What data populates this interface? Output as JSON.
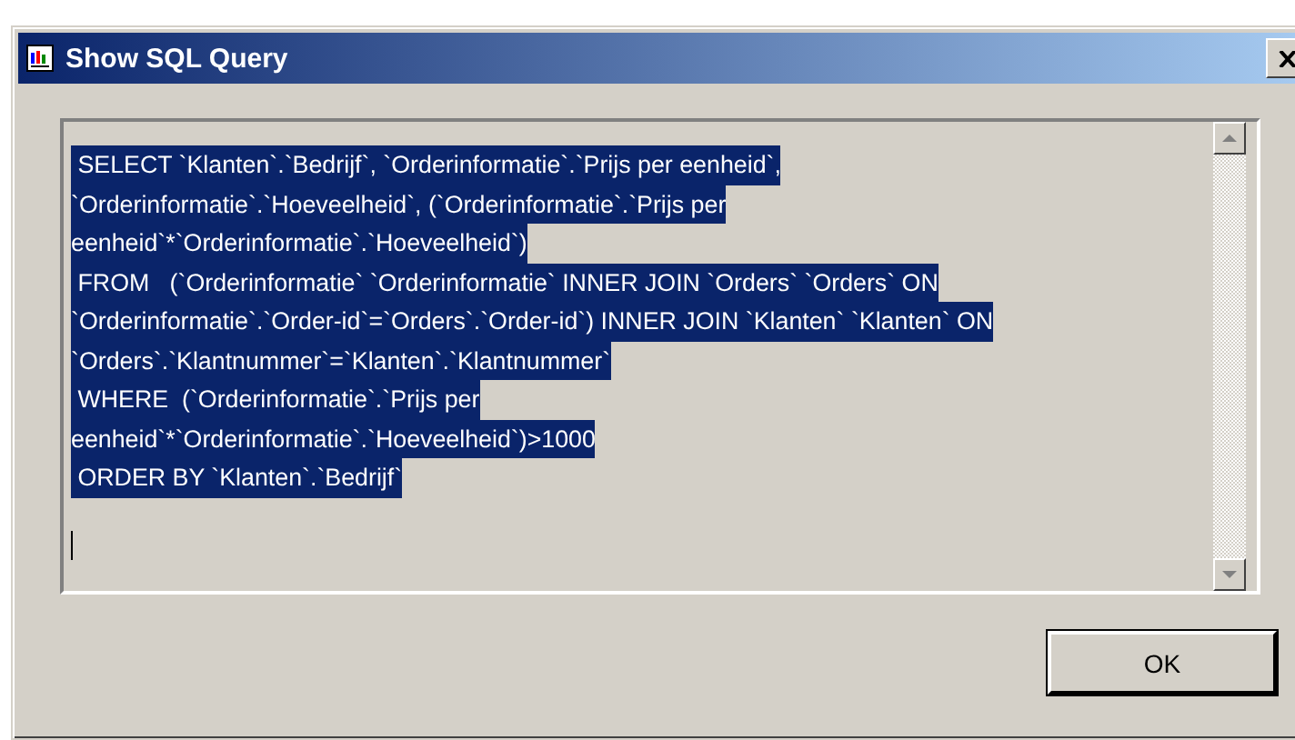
{
  "window": {
    "title": "Show SQL Query"
  },
  "query": {
    "selected": true,
    "lines": [
      " SELECT `Klanten`.`Bedrijf`, `Orderinformatie`.`Prijs per eenheid`,",
      "`Orderinformatie`.`Hoeveelheid`, (`Orderinformatie`.`Prijs per",
      "eenheid`*`Orderinformatie`.`Hoeveelheid`)",
      " FROM   (`Orderinformatie` `Orderinformatie` INNER JOIN `Orders` `Orders` ON",
      "`Orderinformatie`.`Order-id`=`Orders`.`Order-id`) INNER JOIN `Klanten` `Klanten` ON",
      "`Orders`.`Klantnummer`=`Klanten`.`Klantnummer`",
      " WHERE  (`Orderinformatie`.`Prijs per",
      "eenheid`*`Orderinformatie`.`Hoeveelheid`)>1000",
      " ORDER BY `Klanten`.`Bedrijf`"
    ]
  },
  "buttons": [
    "OK"
  ]
}
